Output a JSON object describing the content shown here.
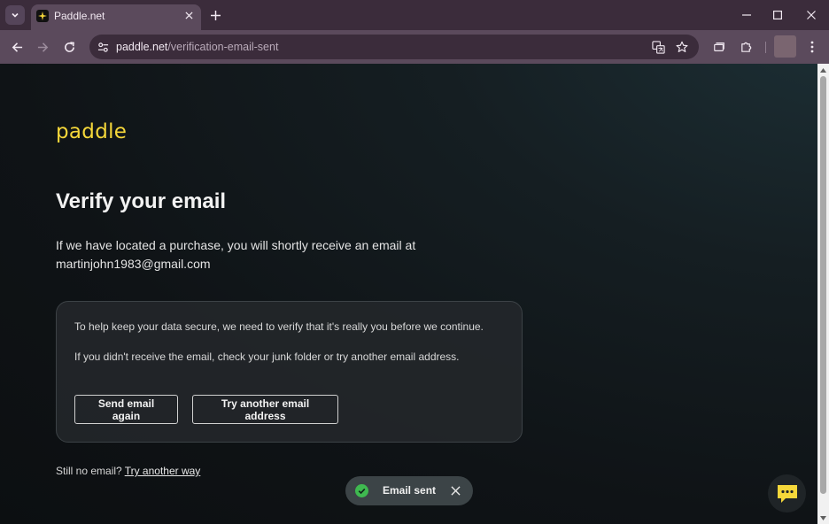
{
  "browser": {
    "tab_title": "Paddle.net",
    "url_host": "paddle.net",
    "url_path": "/verification-email-sent"
  },
  "page": {
    "logo": "paddle",
    "title": "Verify your email",
    "intro_line1": "If we have located a purchase, you will shortly receive an email at",
    "email": "martinjohn1983@gmail.com",
    "card": {
      "paragraph1": "To help keep your data secure, we need to verify that it's really you before we continue.",
      "paragraph2": "If you didn't receive the email, check your junk folder or try another email address.",
      "send_again_label": "Send email again",
      "try_another_label": "Try another email address"
    },
    "footer_text": "Still no email?",
    "footer_link": "Try another way",
    "toast_text": "Email sent"
  },
  "colors": {
    "brand_yellow": "#f5d73a",
    "success_green": "#3fb950",
    "chrome_frame": "#3b2c3b",
    "chrome_toolbar": "#5b4a5c"
  }
}
